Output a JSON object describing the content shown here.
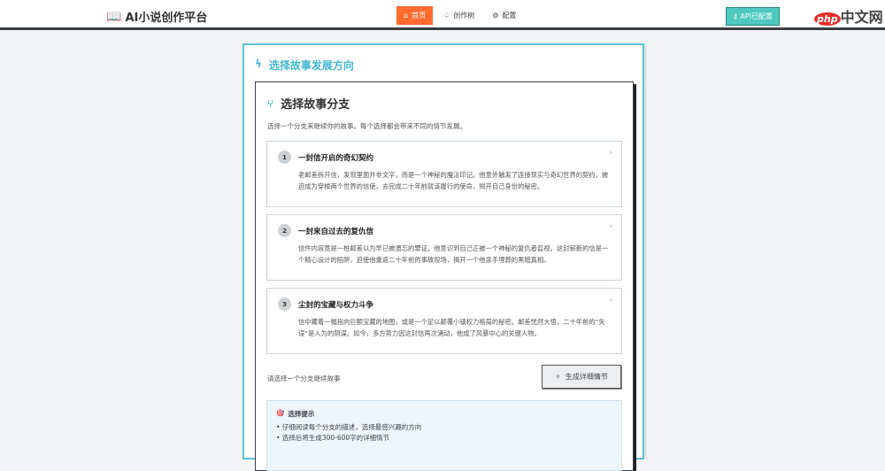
{
  "nav": {
    "logo": "AI小说创作平台",
    "items": [
      {
        "icon": "home-icon",
        "label": "首页",
        "active": true
      },
      {
        "icon": "tree-icon",
        "label": "创作树"
      },
      {
        "icon": "gear-icon",
        "label": "配置"
      }
    ],
    "api_status": "API已配置",
    "watermark": "中文网",
    "watermark_badge": "php"
  },
  "section": {
    "title": "选择故事发展方向"
  },
  "panel": {
    "title": "选择故事分支",
    "description": "选择一个分支来继续你的故事。每个选择都会带来不同的情节发展。",
    "branches": [
      {
        "num": "1",
        "title": "一封信开启的奇幻契约",
        "text": "老邮差拆开信，发现里面并非文字，而是一个神秘的魔法印记。他意外触发了连接现实与奇幻世界的契约，被迫成为穿梭两个世界的信使，去完成二十年前就该履行的使命，揭开自己身份的秘密。"
      },
      {
        "num": "2",
        "title": "一封来自过去的复仇信",
        "text": "信件内容竟是一桩邮差以为早已被遗忘的罪证。他意识到自己正被一个神秘的复仇者监视。这封崭新的信是一个精心设计的陷阱，迫使他重返二十年前的事故现场，揭开一个他亲手埋葬的黑暗真相。"
      },
      {
        "num": "3",
        "title": "尘封的宝藏与权力斗争",
        "text": "信中藏着一幅指向巨额宝藏的地图，或是一个足以颠覆小镇权力格局的秘密。邮差恍然大悟，二十年前的“失误”是人为的阴谋。如今，多方势力因这封信再次涌动，他成了风暴中心的关键人物。"
      }
    ],
    "hint": "请选择一个分支继续故事",
    "generate_label": "生成详细情节",
    "tips": {
      "title": "选择提示",
      "items": [
        "• 仔细阅读每个分支的描述，选择最感兴趣的方向",
        "• 选择后将生成300-600字的详细情节"
      ]
    }
  }
}
